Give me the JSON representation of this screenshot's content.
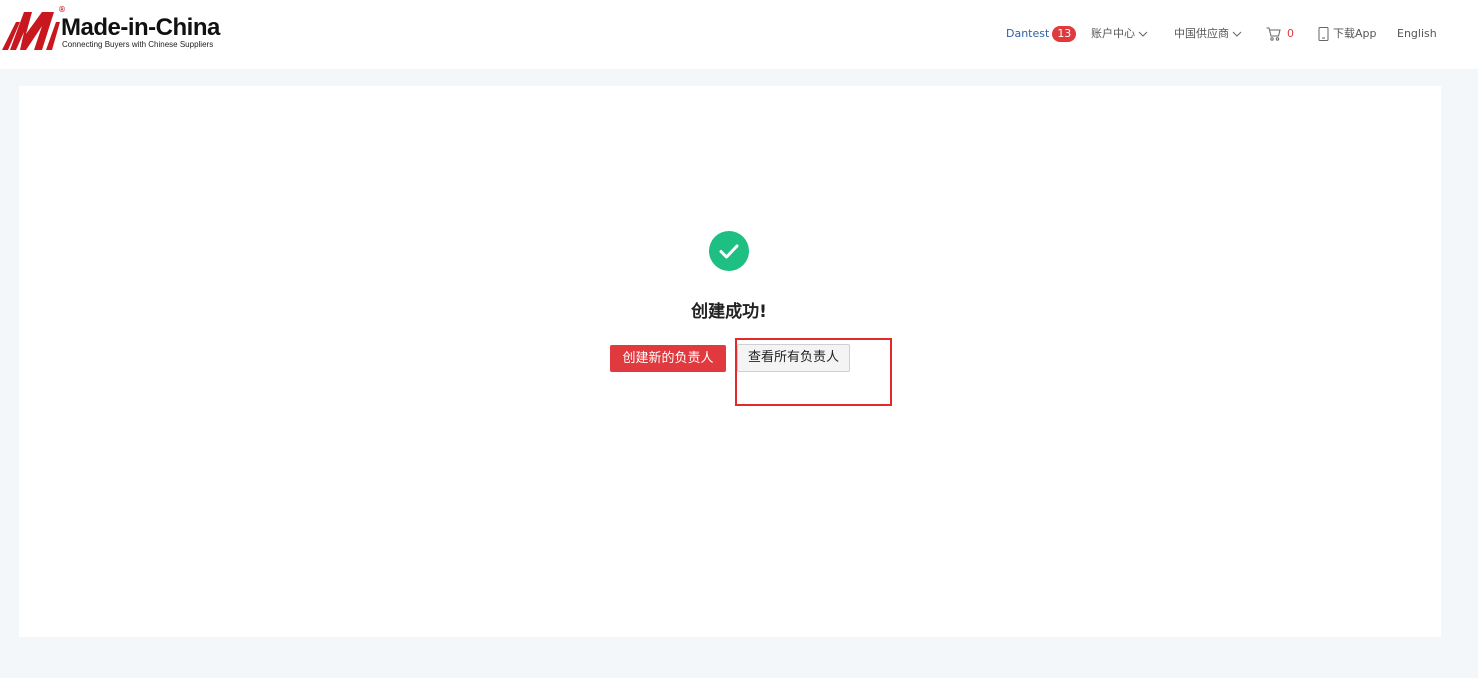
{
  "brand": {
    "name": "Made-in-China",
    "tagline": "Connecting Buyers with Chinese Suppliers",
    "registered_mark": "®",
    "color": "#c8171e"
  },
  "header": {
    "user_name": "Dantest",
    "notification_count": "13",
    "account_center_label": "账户中心",
    "china_supplier_label": "中国供应商",
    "cart_count": "0",
    "download_app_label": "下载App",
    "language_label": "English"
  },
  "result": {
    "title": "创建成功!",
    "status_icon": "check-circle-icon",
    "status_color": "#1dbf82"
  },
  "actions": {
    "create_new_label": "创建新的负责人",
    "view_all_label": "查看所有负责人"
  },
  "colors": {
    "primary": "#e0393e",
    "highlight": "#e12b2b",
    "link": "#2f5fa8"
  }
}
